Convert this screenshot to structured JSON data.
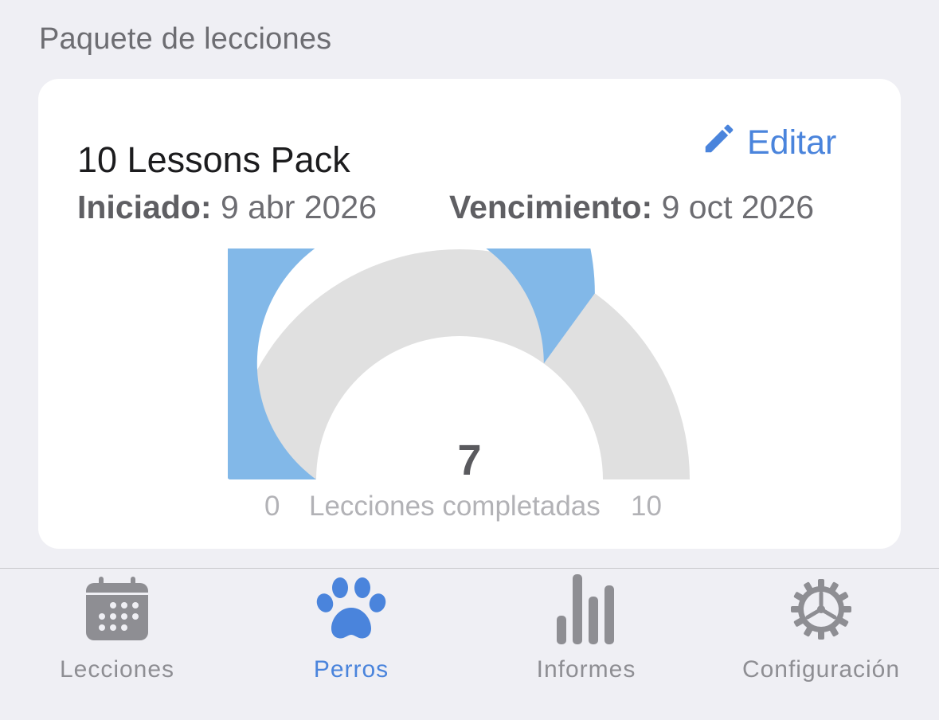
{
  "section": {
    "title": "Paquete de lecciones"
  },
  "pack": {
    "name": "10 Lessons Pack",
    "edit_label": "Editar",
    "start_label": "Iniciado:",
    "start_value": "9 abr 2026",
    "end_label": "Vencimiento:",
    "end_value": "9 oct 2026"
  },
  "gauge": {
    "value": 7,
    "value_text": "7",
    "min": 0,
    "min_text": "0",
    "max": 10,
    "max_text": "10",
    "label": "Lecciones completadas",
    "fill_color": "#82b8e8",
    "track_color": "#e0e0e0"
  },
  "tabs": [
    {
      "label": "Lecciones",
      "icon": "calendar-icon",
      "active": false
    },
    {
      "label": "Perros",
      "icon": "paw-icon",
      "active": true
    },
    {
      "label": "Informes",
      "icon": "bar-chart-icon",
      "active": false
    },
    {
      "label": "Configuración",
      "icon": "gear-icon",
      "active": false
    }
  ],
  "colors": {
    "accent": "#4a84dc",
    "inactive": "#8e8e93"
  }
}
